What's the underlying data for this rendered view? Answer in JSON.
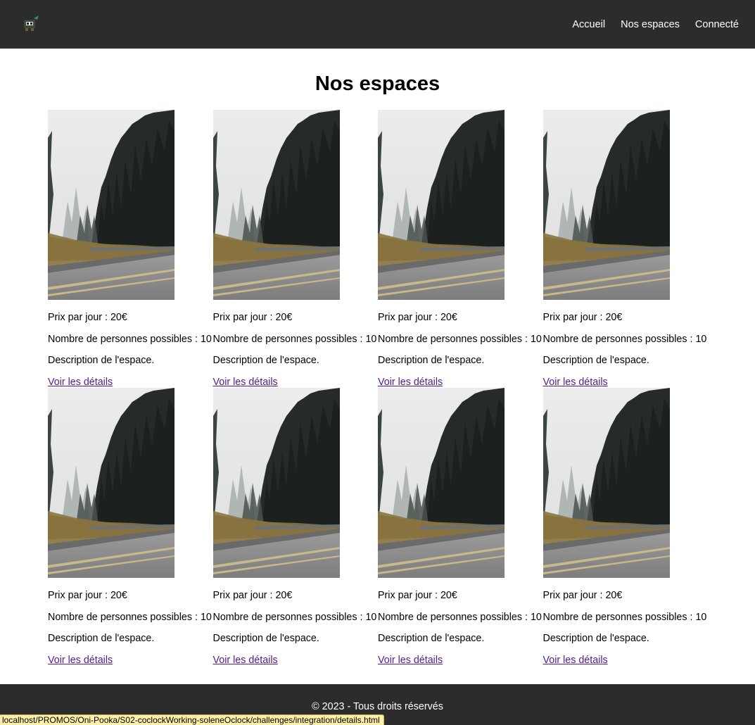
{
  "header": {
    "logo_icon": "robot-logo-icon",
    "nav": [
      {
        "label": "Accueil"
      },
      {
        "label": "Nos espaces"
      },
      {
        "label": "Connecté"
      }
    ]
  },
  "main": {
    "title": "Nos espaces",
    "cards": [
      {
        "price": "Prix par jour : 20€",
        "capacity": "Nombre de personnes possibles : 10",
        "description": "Description de l'espace.",
        "link": "Voir les détails"
      },
      {
        "price": "Prix par jour : 20€",
        "capacity": "Nombre de personnes possibles : 10",
        "description": "Description de l'espace.",
        "link": "Voir les détails"
      },
      {
        "price": "Prix par jour : 20€",
        "capacity": "Nombre de personnes possibles : 10",
        "description": "Description de l'espace.",
        "link": "Voir les détails"
      },
      {
        "price": "Prix par jour : 20€",
        "capacity": "Nombre de personnes possibles : 10",
        "description": "Description de l'espace.",
        "link": "Voir les détails"
      },
      {
        "price": "Prix par jour : 20€",
        "capacity": "Nombre de personnes possibles : 10",
        "description": "Description de l'espace.",
        "link": "Voir les détails"
      },
      {
        "price": "Prix par jour : 20€",
        "capacity": "Nombre de personnes possibles : 10",
        "description": "Description de l'espace.",
        "link": "Voir les détails"
      },
      {
        "price": "Prix par jour : 20€",
        "capacity": "Nombre de personnes possibles : 10",
        "description": "Description de l'espace.",
        "link": "Voir les détails"
      },
      {
        "price": "Prix par jour : 20€",
        "capacity": "Nombre de personnes possibles : 10",
        "description": "Description de l'espace.",
        "link": "Voir les détails"
      }
    ]
  },
  "footer": {
    "text": "© 2023 - Tous droits réservés"
  },
  "status_bar": {
    "url": "localhost/PROMOS/Oni-Pooka/S02-coclockWorking-soleneOclock/challenges/integration/details.html"
  },
  "colors": {
    "header_bg": "#2c2c2c",
    "footer_bg": "#2c2c2c",
    "visited_link": "#551a8b",
    "status_bg": "#fdf0a8"
  }
}
